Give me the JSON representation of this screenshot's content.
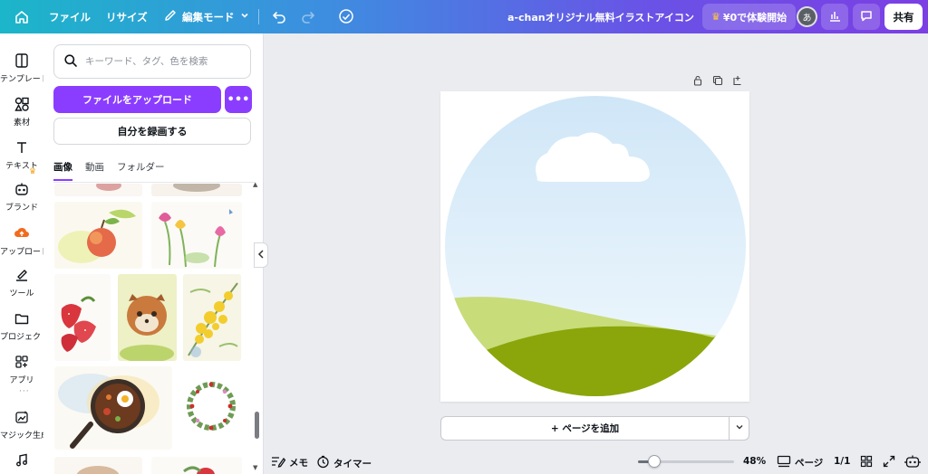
{
  "topbar": {
    "home_icon": "home-icon",
    "file_label": "ファイル",
    "resize_label": "リサイズ",
    "edit_mode_label": "編集モード",
    "design_title": "a-chanオリジナル無料イラストアイコン",
    "trial_label": "¥0で体験開始",
    "avatar_text": "あ",
    "share_label": "共有",
    "gradient_colors": [
      "#1bb6c9",
      "#3d8ee0",
      "#6a52e6",
      "#7b3fe4"
    ]
  },
  "rail": {
    "items": [
      {
        "label": "テンプレート",
        "icon": "template-icon"
      },
      {
        "label": "素材",
        "icon": "elements-icon"
      },
      {
        "label": "テキスト",
        "icon": "text-icon"
      },
      {
        "label": "ブランド",
        "icon": "brand-icon"
      },
      {
        "label": "アップロード",
        "icon": "upload-icon"
      },
      {
        "label": "ツール",
        "icon": "draw-icon"
      },
      {
        "label": "プロジェクト",
        "icon": "folder-icon"
      },
      {
        "label": "アプリ",
        "icon": "apps-icon"
      },
      {
        "label": "マジック生成",
        "icon": "magic-media-icon"
      },
      {
        "label": "",
        "icon": "music-icon"
      }
    ]
  },
  "panel": {
    "search_placeholder": "キーワード、タグ、色を検索",
    "upload_button": "ファイルをアップロード",
    "more_button": "•••",
    "record_button": "自分を録画する",
    "tabs": [
      {
        "label": "画像",
        "active": true
      },
      {
        "label": "動画",
        "active": false
      },
      {
        "label": "フォルダー",
        "active": false
      }
    ]
  },
  "canvas": {
    "add_page_label": "+ ページを追加",
    "accent": "#8b3dff",
    "sky_top": "#cfe6f7",
    "grass_light": "#c8dc7a",
    "grass_dark": "#8aa60a"
  },
  "bottombar": {
    "notes_label": "メモ",
    "timer_label": "タイマー",
    "zoom_value": 48,
    "zoom_label": "48%",
    "pages_label": "ページ",
    "page_count": "1/1"
  }
}
